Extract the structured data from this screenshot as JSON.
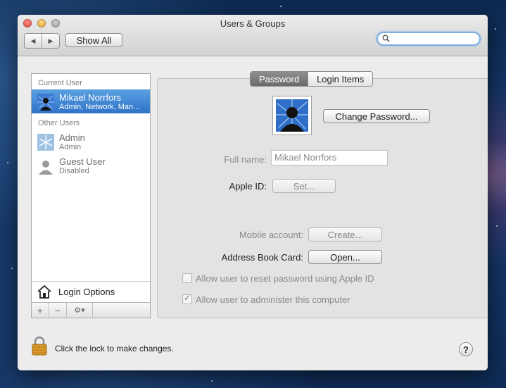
{
  "window": {
    "title": "Users & Groups"
  },
  "toolbar": {
    "show_all_label": "Show All",
    "search_placeholder": ""
  },
  "sidebar": {
    "current_user_header": "Current User",
    "current_user": {
      "name": "Mikael Norrfors",
      "role": "Admin, Network, Man..."
    },
    "other_users_header": "Other Users",
    "other_users": [
      {
        "name": "Admin",
        "role": "Admin"
      },
      {
        "name": "Guest User",
        "role": "Disabled"
      }
    ],
    "login_options_label": "Login Options",
    "tools": {
      "add": "+",
      "remove": "−",
      "gear": "⚙▾"
    }
  },
  "tabs": [
    {
      "label": "Password",
      "active": true
    },
    {
      "label": "Login Items",
      "active": false
    }
  ],
  "details": {
    "change_password_label": "Change Password...",
    "full_name_label": "Full name:",
    "full_name_value": "Mikael Norrfors",
    "apple_id_label": "Apple ID:",
    "apple_id_button": "Set...",
    "mobile_account_label": "Mobile account:",
    "mobile_account_button": "Create...",
    "address_book_label": "Address Book Card:",
    "address_book_button": "Open...",
    "reset_password_label": "Allow user to reset password using Apple ID",
    "reset_password_checked": false,
    "administer_label": "Allow user to administer this computer",
    "administer_checked": true
  },
  "footer": {
    "lock_text": "Click the lock to make changes.",
    "help_label": "?"
  },
  "colors": {
    "selection": "#3a7fd0",
    "search_focus": "#7eaee2"
  }
}
